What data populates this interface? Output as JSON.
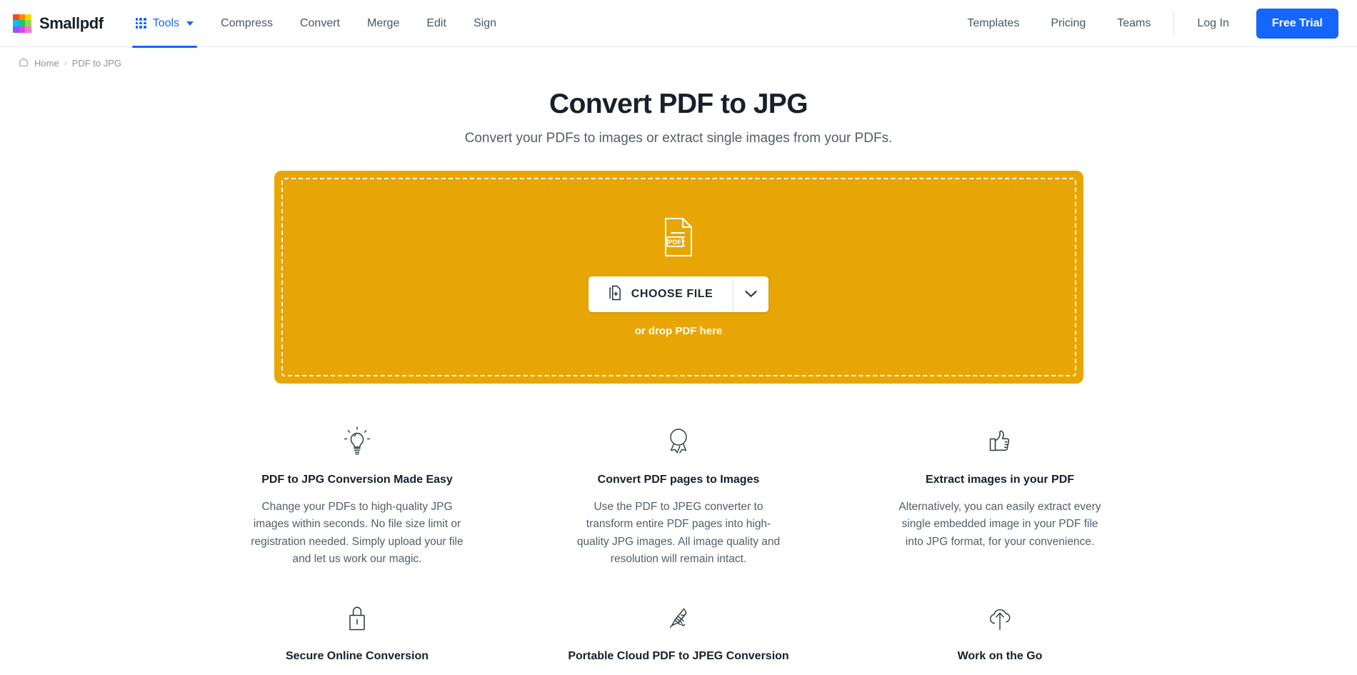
{
  "brand": {
    "name": "Smallpdf",
    "logo_colors": [
      "#FF4713",
      "#FF8A00",
      "#FFD500",
      "#00C2FF",
      "#22C55E",
      "#8ED94A",
      "#8B5CF6",
      "#E040FB",
      "#FF6FD8"
    ]
  },
  "nav": {
    "tools_label": "Tools",
    "tools_icon": "grid-dots-icon",
    "tools_caret_icon": "caret-down-icon",
    "items": [
      "Compress",
      "Convert",
      "Merge",
      "Edit",
      "Sign"
    ],
    "right_links": [
      "Templates",
      "Pricing",
      "Teams"
    ],
    "login_label": "Log In",
    "trial_label": "Free Trial",
    "accent_color": "#1565ff"
  },
  "breadcrumb": {
    "home_icon": "home-icon",
    "home_label": "Home",
    "separator": "›",
    "current": "PDF to JPG"
  },
  "hero": {
    "title": "Convert PDF to JPG",
    "subtitle": "Convert your PDFs to images or extract single images from your PDFs."
  },
  "dropzone": {
    "background_color": "#E8A606",
    "file_icon": "pdf-document-icon",
    "file_icon_badge": "PDF",
    "choose_file_label": "CHOOSE FILE",
    "choose_file_icon": "add-file-icon",
    "dropdown_icon": "chevron-down-icon",
    "hint": "or drop PDF here"
  },
  "features": [
    {
      "icon": "lightbulb-icon",
      "title": "PDF to JPG Conversion Made Easy",
      "body": "Change your PDFs to high-quality JPG images within seconds. No file size limit or registration needed. Simply upload your file and let us work our magic."
    },
    {
      "icon": "award-ribbon-icon",
      "title": "Convert PDF pages to Images",
      "body": "Use the PDF to JPEG converter to transform entire PDF pages into high-quality JPG images. All image quality and resolution will remain intact."
    },
    {
      "icon": "thumbs-up-icon",
      "title": "Extract images in your PDF",
      "body": "Alternatively, you can easily extract every single embedded image in your PDF file into JPG format, for your convenience."
    },
    {
      "icon": "lock-icon",
      "title": "Secure Online Conversion",
      "body": ""
    },
    {
      "icon": "swiss-knife-icon",
      "title": "Portable Cloud PDF to JPEG Conversion",
      "body": ""
    },
    {
      "icon": "cloud-upload-icon",
      "title": "Work on the Go",
      "body": ""
    }
  ]
}
